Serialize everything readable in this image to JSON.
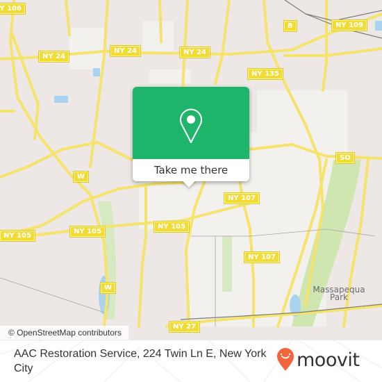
{
  "map": {
    "road_labels": [
      {
        "id": "ny106",
        "text": "NY 106"
      },
      {
        "id": "ny24a",
        "text": "NY 24"
      },
      {
        "id": "ny24b",
        "text": "NY 24"
      },
      {
        "id": "ny24c",
        "text": "NY 24"
      },
      {
        "id": "b",
        "text": "B"
      },
      {
        "id": "ny109",
        "text": "NY 109"
      },
      {
        "id": "ny135",
        "text": "NY 135"
      },
      {
        "id": "w1",
        "text": "W"
      },
      {
        "id": "so",
        "text": "SO"
      },
      {
        "id": "ny107a",
        "text": "NY 107"
      },
      {
        "id": "ny105a",
        "text": "NY 105"
      },
      {
        "id": "ny105b",
        "text": "NY 105"
      },
      {
        "id": "ny105c",
        "text": "NY 105"
      },
      {
        "id": "ny107b",
        "text": "NY 107"
      },
      {
        "id": "w2",
        "text": "W"
      },
      {
        "id": "ny27",
        "text": "NY 27"
      }
    ],
    "place_label": "Massapequa\nPark",
    "attribution": "© OpenStreetMap contributors",
    "colors": {
      "road": "#f5e36b",
      "background": "#ede8e6",
      "park": "#cfe6b0",
      "water": "#a9d3ee"
    }
  },
  "popup": {
    "icon": "location-pin-icon",
    "button_label": "Take me there",
    "accent_color": "#1eb56b"
  },
  "footer": {
    "address": "AAC Restoration Service, 224 Twin Ln E, New York City",
    "logo_text": "moovit",
    "logo_color": "#f2643c"
  }
}
